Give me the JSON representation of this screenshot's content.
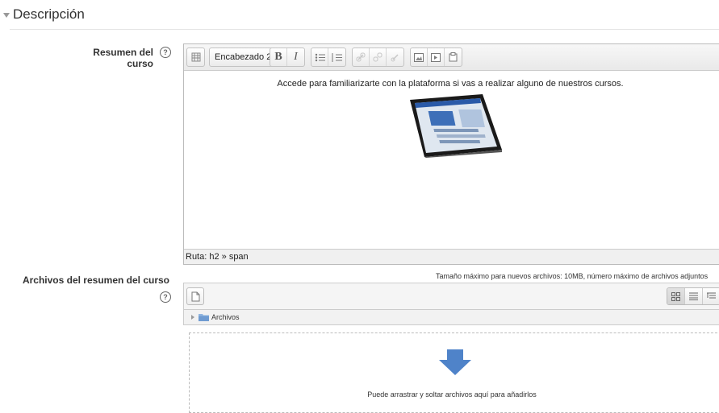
{
  "section": {
    "title": "Descripción"
  },
  "summary_field": {
    "label": "Resumen del curso",
    "help_glyph": "?",
    "format_select": "Encabezado 2",
    "toolbar_icons": [
      "toggle-toolbar-icon",
      "format-select",
      "bold-icon",
      "italic-icon",
      "unordered-list-icon",
      "ordered-list-icon",
      "link-icon",
      "unlink-icon",
      "anchor-icon",
      "image-icon",
      "media-icon",
      "manage-files-icon"
    ],
    "bold_glyph": "B",
    "italic_glyph": "I",
    "content_text": "Accede  para familiarizarte con la plataforma si vas a realizar alguno de nuestros cursos.",
    "path_label": "Ruta: h2 » span"
  },
  "files_field": {
    "label": "Archivos del resumen del curso",
    "help_glyph": "?",
    "limits_text": "Tamaño máximo para nuevos archivos: 10MB, número máximo de archivos adjuntos",
    "folder_label": "Archivos",
    "drop_text": "Puede arrastrar y soltar archivos aquí para añadirlos",
    "views": [
      "icons-view",
      "list-view",
      "tree-view"
    ]
  },
  "colors": {
    "accent_blue": "#4f83c9",
    "folder_blue": "#8fb4e0"
  }
}
